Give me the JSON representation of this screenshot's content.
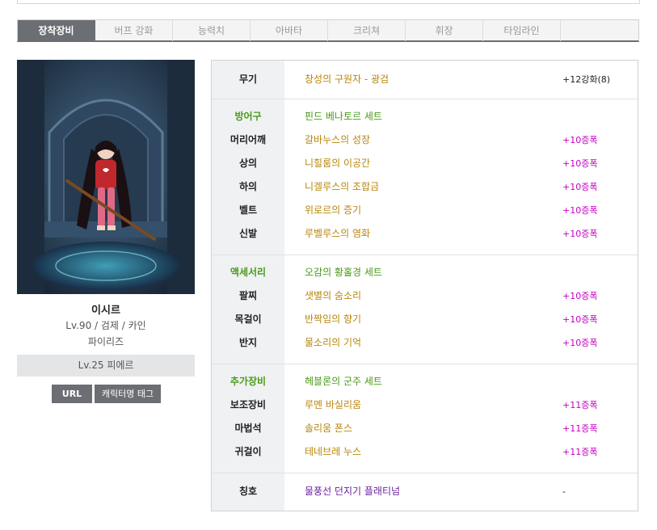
{
  "tabs": [
    {
      "label": "장착장비",
      "active": true
    },
    {
      "label": "버프 강화",
      "active": false
    },
    {
      "label": "능력치",
      "active": false
    },
    {
      "label": "아바타",
      "active": false
    },
    {
      "label": "크리쳐",
      "active": false
    },
    {
      "label": "휘장",
      "active": false
    },
    {
      "label": "타임라인",
      "active": false
    }
  ],
  "character": {
    "name": "이시르",
    "info": "Lv.90 / 검제 / 카인",
    "guild": "파이리즈",
    "adventure": "Lv.25 피에르",
    "url_button": "URL",
    "tag_button": "캐릭터명 태그"
  },
  "equipment": {
    "weapon": {
      "label": "무기",
      "name": "창성의 구원자 - 광검",
      "enhance": "+12강화(8)"
    },
    "armor_set": {
      "label": "방어구",
      "name": "핀드 베나토르 세트"
    },
    "armor": [
      {
        "label": "머리어깨",
        "name": "갈바누스의 성장",
        "enhance": "+10증폭"
      },
      {
        "label": "상의",
        "name": "니힐룸의 이공간",
        "enhance": "+10증폭"
      },
      {
        "label": "하의",
        "name": "니겔루스의 조합금",
        "enhance": "+10증폭"
      },
      {
        "label": "벨트",
        "name": "위로르의 증기",
        "enhance": "+10증폭"
      },
      {
        "label": "신발",
        "name": "루벨루스의 염화",
        "enhance": "+10증폭"
      }
    ],
    "accessory_set": {
      "label": "액세서리",
      "name": "오감의 황홀경 세트"
    },
    "accessories": [
      {
        "label": "팔찌",
        "name": "샛별의 숨소리",
        "enhance": "+10증폭"
      },
      {
        "label": "목걸이",
        "name": "반짝임의 향기",
        "enhance": "+10증폭"
      },
      {
        "label": "반지",
        "name": "물소리의 기억",
        "enhance": "+10증폭"
      }
    ],
    "special_set": {
      "label": "추가장비",
      "name": "헤블론의 군주 세트"
    },
    "special": [
      {
        "label": "보조장비",
        "name": "루멘 바실리움",
        "enhance": "+11증폭"
      },
      {
        "label": "마법석",
        "name": "솔리움 폰스",
        "enhance": "+11증폭"
      },
      {
        "label": "귀걸이",
        "name": "테네브레 누스",
        "enhance": "+11증폭"
      }
    ],
    "title": {
      "label": "칭호",
      "name": "물풍선 던지기 플래티넘",
      "enhance": "-"
    }
  },
  "colors": {
    "tab_active": "#6b6e73",
    "item_name": "#b8860b",
    "set_name": "#4a9a1a",
    "enhance": "#c400c4",
    "title_name": "#6a1fa0"
  }
}
